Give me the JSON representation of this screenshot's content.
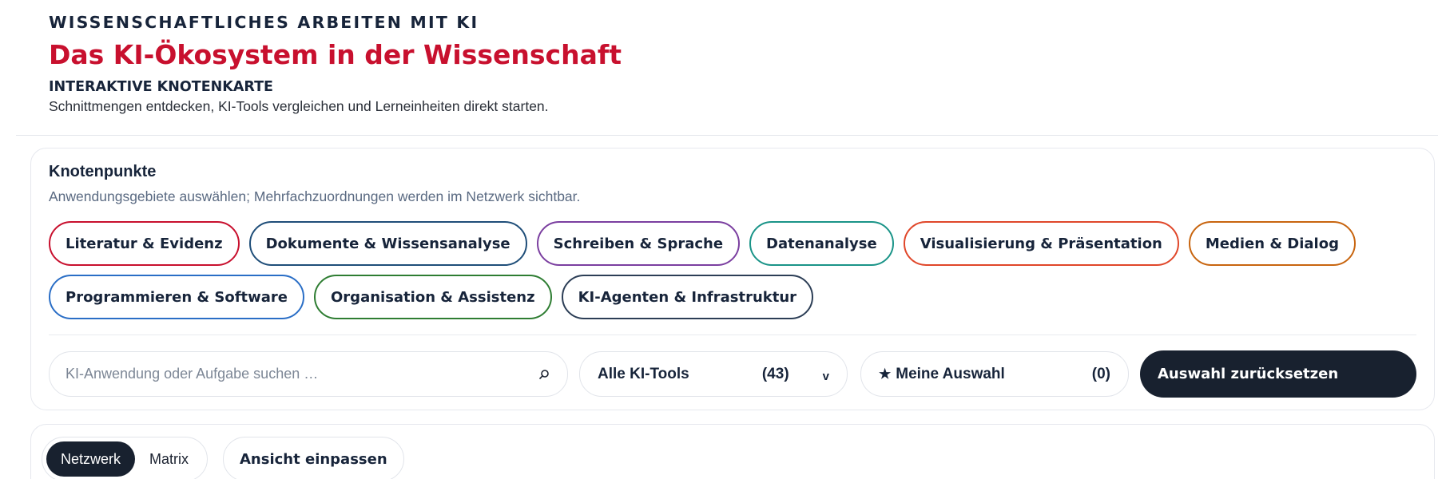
{
  "header": {
    "eyebrow": "WISSENSCHAFTLICHES ARBEITEN MIT KI",
    "title": "Das KI-Ökosystem in der Wissenschaft",
    "subtitle": "INTERAKTIVE KNOTENKARTE",
    "description": "Schnittmengen entdecken, KI-Tools vergleichen und Lerneinheiten direkt starten."
  },
  "nodes_panel": {
    "title": "Knotenpunkte",
    "description": "Anwendungsgebiete auswählen; Mehrfachzuordnungen werden im Netzwerk sichtbar.",
    "chips": [
      {
        "label": "Literatur & Evidenz",
        "color": "#c8102e"
      },
      {
        "label": "Dokumente & Wissensanalyse",
        "color": "#1f4e79"
      },
      {
        "label": "Schreiben & Sprache",
        "color": "#7b3fa0"
      },
      {
        "label": "Datenanalyse",
        "color": "#1a9488"
      },
      {
        "label": "Visualisierung & Präsentation",
        "color": "#e0472a"
      },
      {
        "label": "Medien & Dialog",
        "color": "#c8650f"
      },
      {
        "label": "Programmieren & Software",
        "color": "#2a6ec6"
      },
      {
        "label": "Organisation & Assistenz",
        "color": "#2e7d32"
      },
      {
        "label": "KI-Agenten & Infrastruktur",
        "color": "#2c3e56"
      }
    ]
  },
  "search": {
    "placeholder": "KI-Anwendung oder Aufgabe suchen …",
    "icon": "search-icon"
  },
  "tools_filter": {
    "label": "Alle KI-Tools",
    "count": "(43)",
    "chevron": "v"
  },
  "favorites": {
    "star": "★",
    "label": "Meine Auswahl",
    "count": "(0)"
  },
  "reset_button": {
    "label": "Auswahl zurücksetzen"
  },
  "view_controls": {
    "tabs": [
      {
        "label": "Netzwerk",
        "active": true
      },
      {
        "label": "Matrix",
        "active": false
      }
    ],
    "fit_label": "Ansicht einpassen"
  },
  "colors": {
    "accent": "#c8102e",
    "navy": "#17243a",
    "dark_button": "#18212f"
  }
}
